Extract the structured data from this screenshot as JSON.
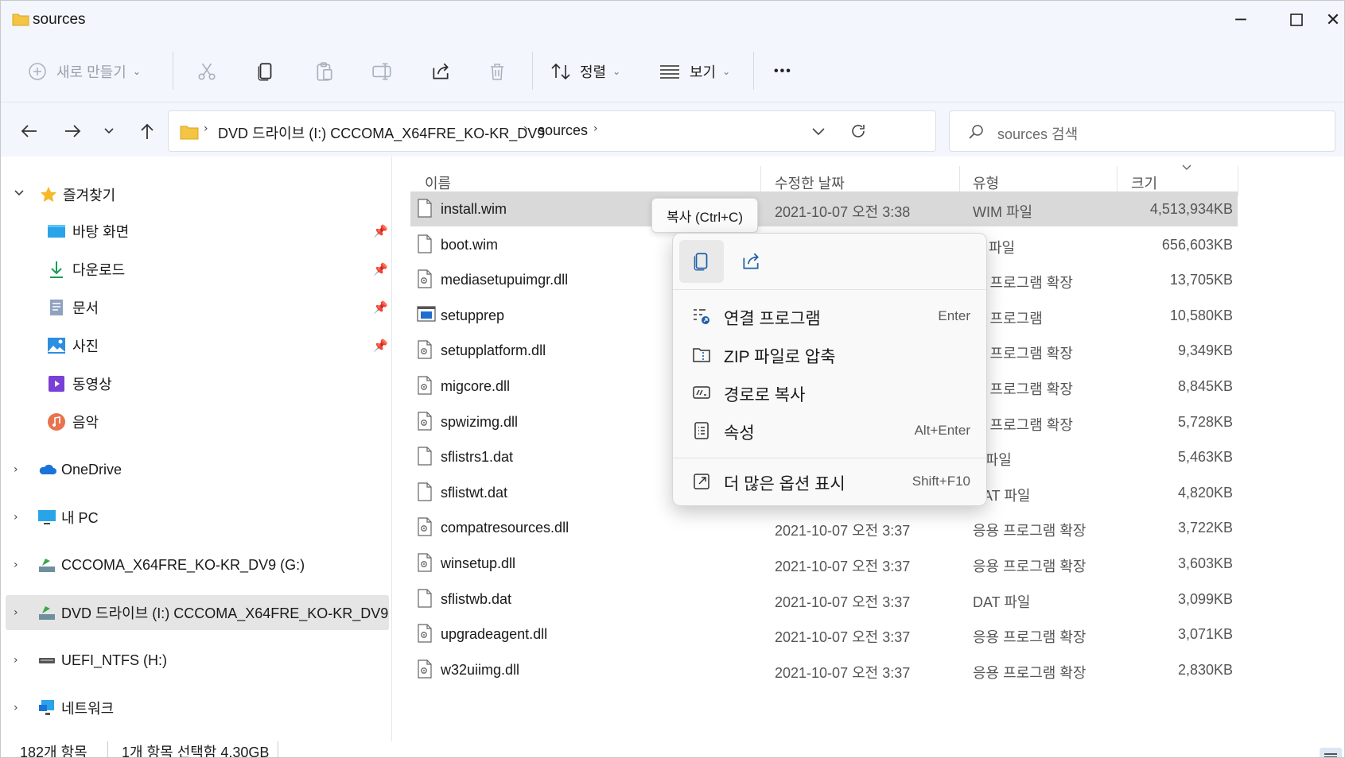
{
  "window": {
    "title": "sources",
    "controls": {
      "minimize": "─",
      "maximize": "☐",
      "close": "✕"
    }
  },
  "toolbar": {
    "new_label": "새로 만들기",
    "sort_label": "정렬",
    "view_label": "보기",
    "more_label": "•••"
  },
  "address": {
    "crumbs": [
      "DVD 드라이브 (I:) CCCOMA_X64FRE_KO-KR_DV9",
      "sources"
    ],
    "search_placeholder": "sources 검색"
  },
  "sidebar": {
    "quick_access": "즐겨찾기",
    "items": [
      {
        "label": "바탕 화면",
        "icon": "desktop-icon",
        "pinned": true
      },
      {
        "label": "다운로드",
        "icon": "download-icon",
        "pinned": true
      },
      {
        "label": "문서",
        "icon": "documents-icon",
        "pinned": true
      },
      {
        "label": "사진",
        "icon": "pictures-icon",
        "pinned": true
      },
      {
        "label": "동영상",
        "icon": "videos-icon",
        "pinned": false
      },
      {
        "label": "음악",
        "icon": "music-icon",
        "pinned": false
      }
    ],
    "roots": [
      {
        "label": "OneDrive",
        "icon": "onedrive-icon"
      },
      {
        "label": "내 PC",
        "icon": "pc-icon"
      },
      {
        "label": "CCCOMA_X64FRE_KO-KR_DV9 (G:)",
        "icon": "drive-icon"
      },
      {
        "label": "DVD 드라이브 (I:) CCCOMA_X64FRE_KO-KR_DV9",
        "icon": "dvd-icon",
        "selected": true
      },
      {
        "label": "UEFI_NTFS (H:)",
        "icon": "usb-drive-icon"
      },
      {
        "label": "네트워크",
        "icon": "network-icon"
      }
    ]
  },
  "columns": {
    "name": "이름",
    "date": "수정한 날짜",
    "type": "유형",
    "size": "크기"
  },
  "files": [
    {
      "name": "install.wim",
      "date": "2021-10-07 오전 3:38",
      "type": "WIM 파일",
      "size": "4,513,934KB",
      "icon": "file",
      "selected": true
    },
    {
      "name": "boot.wim",
      "date": "",
      "type": "M 파일",
      "size": "656,603KB",
      "icon": "file"
    },
    {
      "name": "mediasetupuimgr.dll",
      "date": "",
      "type": "용 프로그램 확장",
      "size": "13,705KB",
      "icon": "dll"
    },
    {
      "name": "setupprep",
      "date": "",
      "type": "용 프로그램",
      "size": "10,580KB",
      "icon": "exe"
    },
    {
      "name": "setupplatform.dll",
      "date": "",
      "type": "용 프로그램 확장",
      "size": "9,349KB",
      "icon": "dll"
    },
    {
      "name": "migcore.dll",
      "date": "",
      "type": "용 프로그램 확장",
      "size": "8,845KB",
      "icon": "dll"
    },
    {
      "name": "spwizimg.dll",
      "date": "",
      "type": "용 프로그램 확장",
      "size": "5,728KB",
      "icon": "dll"
    },
    {
      "name": "sflistrs1.dat",
      "date": "",
      "type": "T 파일",
      "size": "5,463KB",
      "icon": "file"
    },
    {
      "name": "sflistwt.dat",
      "date": "2021-10-07 오전 3:37",
      "type": "DAT 파일",
      "size": "4,820KB",
      "icon": "file"
    },
    {
      "name": "compatresources.dll",
      "date": "2021-10-07 오전 3:37",
      "type": "응용 프로그램 확장",
      "size": "3,722KB",
      "icon": "dll"
    },
    {
      "name": "winsetup.dll",
      "date": "2021-10-07 오전 3:37",
      "type": "응용 프로그램 확장",
      "size": "3,603KB",
      "icon": "dll"
    },
    {
      "name": "sflistwb.dat",
      "date": "2021-10-07 오전 3:37",
      "type": "DAT 파일",
      "size": "3,099KB",
      "icon": "file"
    },
    {
      "name": "upgradeagent.dll",
      "date": "2021-10-07 오전 3:37",
      "type": "응용 프로그램 확장",
      "size": "3,071KB",
      "icon": "dll"
    },
    {
      "name": "w32uiimg.dll",
      "date": "2021-10-07 오전 3:37",
      "type": "응용 프로그램 확장",
      "size": "2,830KB",
      "icon": "dll"
    }
  ],
  "tooltip": "복사 (Ctrl+C)",
  "context_menu": {
    "items": [
      {
        "label": "연결 프로그램",
        "shortcut": "Enter",
        "icon": "open-with-icon"
      },
      {
        "label": "ZIP 파일로 압축",
        "shortcut": "",
        "icon": "zip-icon"
      },
      {
        "label": "경로로 복사",
        "shortcut": "",
        "icon": "copy-path-icon"
      },
      {
        "label": "속성",
        "shortcut": "Alt+Enter",
        "icon": "properties-icon"
      },
      {
        "label": "더 많은 옵션 표시",
        "shortcut": "Shift+F10",
        "icon": "more-options-icon"
      }
    ]
  },
  "status": {
    "count": "182개 항목",
    "selection": "1개 항목 선택함 4.30GB"
  },
  "colors": {
    "accent": "#0067c0",
    "folder": "#f4c542",
    "selected_row": "#d9d9d9"
  }
}
